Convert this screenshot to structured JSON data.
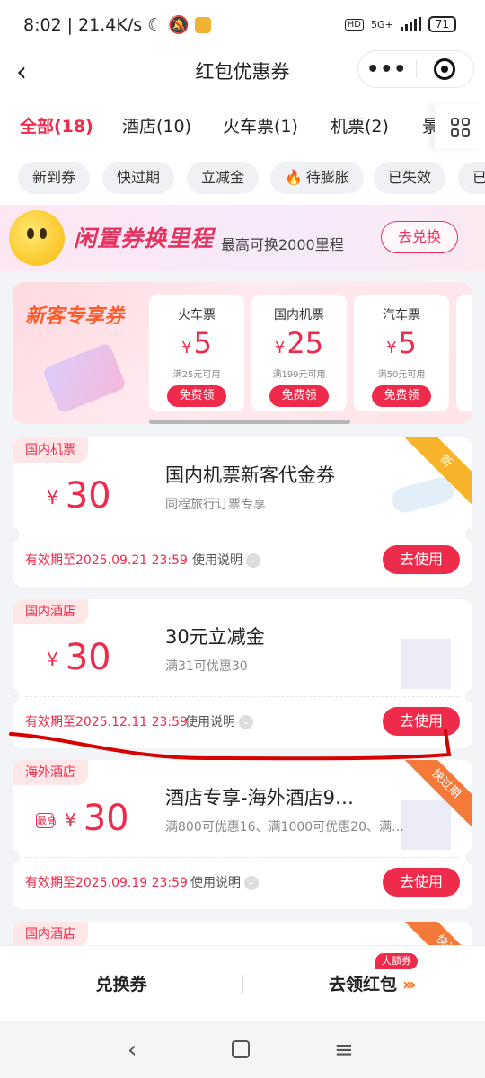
{
  "status": {
    "time": "8:02",
    "speed": "21.4K/s",
    "network": "5G+",
    "battery": "71"
  },
  "nav": {
    "back_icon": "‹",
    "title": "红包优惠券",
    "more_label": "•••"
  },
  "tabs": [
    {
      "label": "全部(18)",
      "active": true
    },
    {
      "label": "酒店(10)"
    },
    {
      "label": "火车票(1)"
    },
    {
      "label": "机票(2)"
    },
    {
      "label": "景"
    }
  ],
  "filters": [
    "新到券",
    "快过期",
    "立减金",
    "待膨胀",
    "已失效",
    "已"
  ],
  "promo": {
    "title": "闲置券换里程",
    "subtitle": "最高可换2000里程",
    "button": "去兑换"
  },
  "new_customer": {
    "title": "新客专享券",
    "cards": [
      {
        "name": "火车票",
        "currency": "¥",
        "value": "5",
        "condition": "满25元可用",
        "button": "免费领"
      },
      {
        "name": "国内机票",
        "currency": "¥",
        "value": "25",
        "condition": "满199元可用",
        "button": "免费领"
      },
      {
        "name": "汽车票",
        "currency": "¥",
        "value": "5",
        "condition": "满50元可用",
        "button": "免费领"
      }
    ]
  },
  "coupons": [
    {
      "tag": "国内机票",
      "currency": "¥",
      "amount": "30",
      "name": "国内机票新客代金券",
      "desc": "同程旅行订票专享",
      "expire": "有效期至2025.09.21 23:59",
      "rule": "使用说明",
      "button": "去使用",
      "corner": "新"
    },
    {
      "tag": "国内酒店",
      "currency": "¥",
      "amount": "30",
      "name": "30元立减金",
      "desc": "满31可优惠30",
      "expire": "有效期至2025.12.11 23:59",
      "rule": "使用说明",
      "button": "去使用"
    },
    {
      "tag": "海外酒店",
      "max_label": "最高",
      "currency": "¥",
      "amount": "30",
      "name": "酒店专享-海外酒店9…",
      "desc": "满800可优惠16、满1000可优惠20、满…",
      "expire": "有效期至2025.09.19 23:59",
      "rule": "使用说明",
      "button": "去使用",
      "corner": "快过期"
    },
    {
      "tag": "国内酒店",
      "corner": "快过"
    }
  ],
  "bottom": {
    "exchange": "兑换券",
    "get_redpacket": "去领红包",
    "badge": "大额券"
  },
  "colors": {
    "accent": "#ee2b4a",
    "annotation_stroke": "#d60000"
  }
}
